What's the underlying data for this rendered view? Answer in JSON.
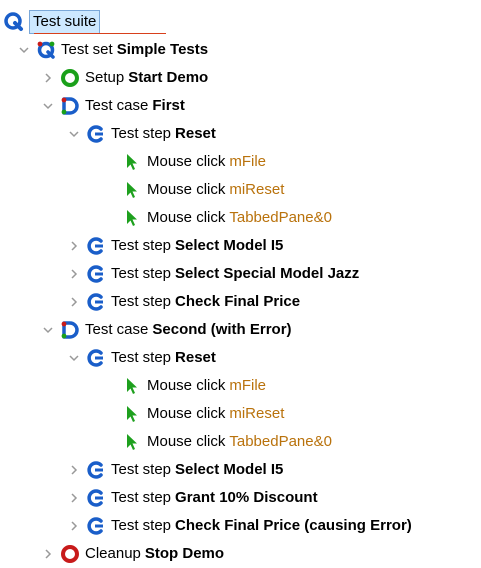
{
  "tree": {
    "root": {
      "label": "Test suite"
    },
    "test_set": {
      "kind": "Test set",
      "name": "Simple Tests"
    },
    "setup": {
      "kind": "Setup",
      "name": "Start Demo"
    },
    "case1": {
      "kind": "Test case",
      "name": "First",
      "step_reset": {
        "kind": "Test step",
        "name": "Reset"
      },
      "clicks": [
        {
          "kind": "Mouse click",
          "target": "mFile"
        },
        {
          "kind": "Mouse click",
          "target": "miReset"
        },
        {
          "kind": "Mouse click",
          "target": "TabbedPane&0"
        }
      ],
      "steps": [
        {
          "kind": "Test step",
          "name": "Select Model I5"
        },
        {
          "kind": "Test step",
          "name": "Select Special Model Jazz"
        },
        {
          "kind": "Test step",
          "name": "Check Final Price"
        }
      ]
    },
    "case2": {
      "kind": "Test case",
      "name": "Second (with Error)",
      "step_reset": {
        "kind": "Test step",
        "name": "Reset"
      },
      "clicks": [
        {
          "kind": "Mouse click",
          "target": "mFile"
        },
        {
          "kind": "Mouse click",
          "target": "miReset"
        },
        {
          "kind": "Mouse click",
          "target": "TabbedPane&0"
        }
      ],
      "steps": [
        {
          "kind": "Test step",
          "name": "Select Model I5"
        },
        {
          "kind": "Test step",
          "name": "Grant 10% Discount"
        },
        {
          "kind": "Test step",
          "name": "Check Final Price (causing Error)"
        }
      ]
    },
    "cleanup": {
      "kind": "Cleanup",
      "name": "Stop Demo"
    }
  },
  "colors": {
    "accent_blue": "#1a5ec9",
    "setup_green": "#1aa01a",
    "cleanup_red": "#c81a1a",
    "mouse_green": "#1ea01e",
    "target_orange": "#b9720c",
    "selection_bg": "#cde8ff"
  },
  "icons": {
    "suite": "test-suite-icon",
    "set": "test-set-icon",
    "setup": "setup-icon",
    "case": "test-case-icon",
    "step": "test-step-icon",
    "mouse": "mouse-click-icon",
    "cleanup": "cleanup-icon",
    "expanded": "chevron-down-icon",
    "collapsed": "chevron-right-icon"
  }
}
